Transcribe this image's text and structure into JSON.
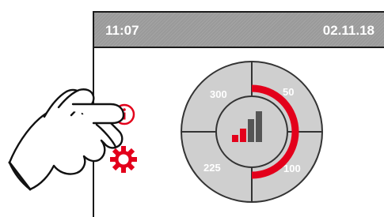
{
  "status_bar": {
    "time": "11:07",
    "date": "02.11.18"
  },
  "dial": {
    "segments": {
      "top_left": "300",
      "top_right": "50",
      "bottom_right": "100",
      "bottom_left": "225"
    },
    "center_icon": "signal-bars-icon"
  },
  "side_icons": [
    "info-icon",
    "gear-icon"
  ],
  "overlay": {
    "icon": "pointing-hand-icon"
  },
  "colors": {
    "status_bar": "#9a9a9a",
    "accent": "#e3001b",
    "dial_fill": "#cfcfcf",
    "bars_dark": "#555555"
  }
}
